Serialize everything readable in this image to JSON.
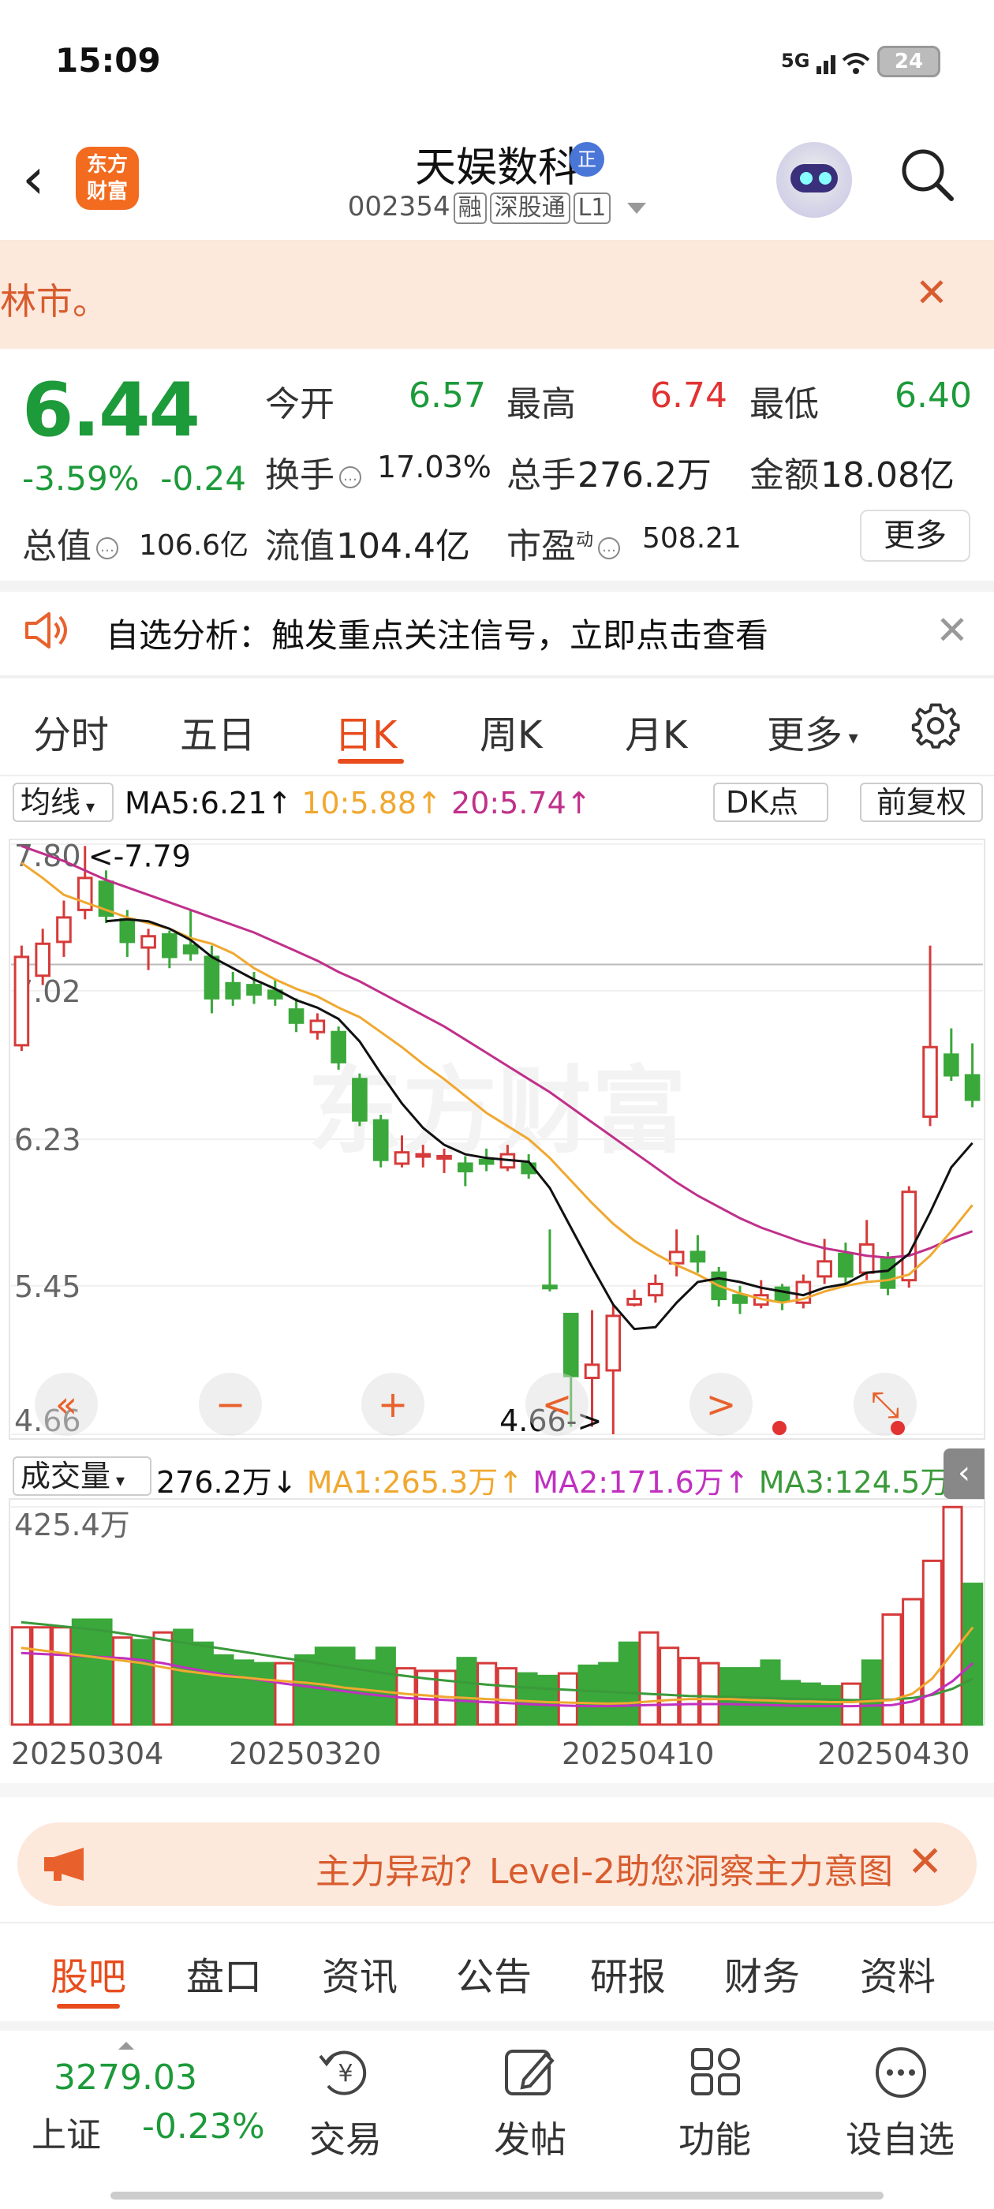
{
  "status": {
    "time": "15:09",
    "signal": "5G",
    "battery": "24"
  },
  "header": {
    "logo": [
      "东方",
      "财富"
    ],
    "name": "天娱数科",
    "name_badge": "正",
    "code": "002354",
    "tags": [
      "融",
      "深股通",
      "L1"
    ]
  },
  "banner": {
    "text": "林市。"
  },
  "quote": {
    "price": "6.44",
    "pct": "-3.59%",
    "chg": "-0.24",
    "open_label": "今开",
    "open": "6.57",
    "high_label": "最高",
    "high": "6.74",
    "low_label": "最低",
    "low": "6.40",
    "turnover_label": "换手",
    "turnover": "17.03%",
    "volume_label": "总手",
    "volume": "276.2万",
    "amount_label": "金额",
    "amount": "18.08亿",
    "mcap_label": "总值",
    "mcap": "106.6亿",
    "float_label": "流值",
    "float": "104.4亿",
    "pe_label": "市盈",
    "pe_sup": "动",
    "pe": "508.21",
    "more": "更多"
  },
  "analysis": {
    "text": "自选分析：触发重点关注信号，立即点击查看"
  },
  "period_tabs": [
    "分时",
    "五日",
    "日K",
    "周K",
    "月K",
    "更多"
  ],
  "ma_row": {
    "selector": "均线",
    "ma5": "MA5:6.21",
    "ma10": "10:5.88",
    "ma20": "20:5.74",
    "dk": "DK点",
    "adjust": "前复权"
  },
  "colors": {
    "ma5": "#111111",
    "ma10": "#f0a830",
    "ma20": "#c0308a",
    "up": "#d63a3a",
    "down": "#3aa83a",
    "accent": "#e84c1c"
  },
  "chart_data": [
    {
      "type": "candlestick",
      "ylim": [
        4.66,
        7.8
      ],
      "y_ticks": [
        "7.80",
        "7.02",
        "6.23",
        "5.45",
        "4.66"
      ],
      "high_marker": "<-7.79",
      "low_marker": "4.66->",
      "watermark": "东方财富",
      "x_labels": [
        "20250304",
        "20250320",
        "20250410",
        "20250430"
      ],
      "reference_line": 7.16,
      "candles": [
        [
          6.73,
          7.2,
          7.26,
          6.7
        ],
        [
          7.1,
          7.27,
          7.35,
          7.05
        ],
        [
          7.28,
          7.41,
          7.5,
          7.2
        ],
        [
          7.45,
          7.62,
          7.79,
          7.4
        ],
        [
          7.6,
          7.42,
          7.66,
          7.38
        ],
        [
          7.4,
          7.28,
          7.45,
          7.2
        ],
        [
          7.25,
          7.31,
          7.35,
          7.13
        ],
        [
          7.32,
          7.2,
          7.34,
          7.14
        ],
        [
          7.26,
          7.22,
          7.45,
          7.18
        ],
        [
          7.2,
          6.98,
          7.26,
          6.9
        ],
        [
          7.06,
          6.98,
          7.12,
          6.94
        ],
        [
          7.05,
          7.0,
          7.12,
          6.95
        ],
        [
          7.02,
          6.98,
          7.08,
          6.94
        ],
        [
          6.92,
          6.85,
          6.98,
          6.8
        ],
        [
          6.8,
          6.86,
          6.9,
          6.76
        ],
        [
          6.8,
          6.64,
          6.83,
          6.6
        ],
        [
          6.55,
          6.33,
          6.58,
          6.3
        ],
        [
          6.33,
          6.12,
          6.36,
          6.08
        ],
        [
          6.1,
          6.16,
          6.25,
          6.08
        ],
        [
          6.14,
          6.15,
          6.2,
          6.08
        ],
        [
          6.14,
          6.14,
          6.18,
          6.05
        ],
        [
          6.1,
          6.06,
          6.14,
          5.98
        ],
        [
          6.12,
          6.1,
          6.18,
          6.06
        ],
        [
          6.08,
          6.15,
          6.2,
          6.06
        ],
        [
          6.1,
          6.05,
          6.15,
          6.02
        ],
        [
          5.45,
          5.44,
          5.75,
          5.42
        ],
        [
          5.3,
          4.97,
          5.3,
          4.7
        ],
        [
          4.96,
          5.03,
          5.32,
          4.7
        ],
        [
          5.0,
          5.29,
          5.35,
          4.66
        ],
        [
          5.35,
          5.38,
          5.43,
          5.34
        ],
        [
          5.4,
          5.46,
          5.51,
          5.36
        ],
        [
          5.57,
          5.63,
          5.75,
          5.5
        ],
        [
          5.63,
          5.58,
          5.72,
          5.52
        ],
        [
          5.52,
          5.38,
          5.55,
          5.34
        ],
        [
          5.4,
          5.36,
          5.45,
          5.3
        ],
        [
          5.35,
          5.4,
          5.48,
          5.33
        ],
        [
          5.44,
          5.37,
          5.46,
          5.32
        ],
        [
          5.36,
          5.47,
          5.51,
          5.33
        ],
        [
          5.5,
          5.58,
          5.7,
          5.46
        ],
        [
          5.62,
          5.5,
          5.68,
          5.46
        ],
        [
          5.52,
          5.67,
          5.8,
          5.48
        ],
        [
          5.6,
          5.44,
          5.63,
          5.4
        ],
        [
          5.48,
          5.95,
          5.98,
          5.44
        ],
        [
          6.35,
          6.72,
          7.26,
          6.3
        ],
        [
          6.68,
          6.57,
          6.82,
          6.54
        ],
        [
          6.57,
          6.44,
          6.74,
          6.4
        ]
      ],
      "ma5": [
        null,
        null,
        null,
        null,
        7.39,
        7.4,
        7.39,
        7.35,
        7.29,
        7.2,
        7.14,
        7.08,
        7.03,
        6.97,
        6.93,
        6.87,
        6.75,
        6.58,
        6.42,
        6.29,
        6.2,
        6.15,
        6.13,
        6.12,
        6.11,
        5.97,
        5.76,
        5.55,
        5.35,
        5.22,
        5.23,
        5.36,
        5.47,
        5.49,
        5.47,
        5.44,
        5.42,
        5.4,
        5.44,
        5.46,
        5.52,
        5.53,
        5.62,
        5.84,
        6.08,
        6.21
      ],
      "ma10": [
        7.7,
        7.62,
        7.53,
        7.49,
        7.45,
        7.41,
        7.38,
        7.35,
        7.3,
        7.27,
        7.22,
        7.14,
        7.08,
        7.03,
        6.99,
        6.93,
        6.88,
        6.8,
        6.72,
        6.63,
        6.55,
        6.46,
        6.37,
        6.3,
        6.23,
        6.13,
        6.01,
        5.89,
        5.78,
        5.69,
        5.62,
        5.56,
        5.51,
        5.45,
        5.41,
        5.38,
        5.36,
        5.38,
        5.42,
        5.45,
        5.47,
        5.48,
        5.51,
        5.61,
        5.74,
        5.88
      ],
      "ma20": [
        7.79,
        7.75,
        7.71,
        7.66,
        7.61,
        7.57,
        7.53,
        7.49,
        7.45,
        7.41,
        7.37,
        7.33,
        7.28,
        7.23,
        7.18,
        7.12,
        7.07,
        7.01,
        6.95,
        6.89,
        6.83,
        6.76,
        6.69,
        6.62,
        6.55,
        6.48,
        6.4,
        6.32,
        6.24,
        6.16,
        6.08,
        6.0,
        5.93,
        5.87,
        5.81,
        5.76,
        5.72,
        5.68,
        5.65,
        5.63,
        5.61,
        5.6,
        5.61,
        5.65,
        5.7,
        5.74
      ]
    },
    {
      "type": "bar",
      "label": "成交量",
      "ylim": [
        0,
        425.4
      ],
      "y_tick": "425.4万",
      "current": "276.2万",
      "ma1": "MA1:265.3万",
      "ma2": "MA2:171.6万",
      "ma3": "MA3:124.5万",
      "volumes": [
        190,
        190,
        190,
        205,
        205,
        170,
        165,
        180,
        185,
        160,
        135,
        125,
        120,
        120,
        135,
        150,
        150,
        125,
        150,
        110,
        105,
        105,
        130,
        120,
        110,
        100,
        95,
        100,
        115,
        120,
        160,
        180,
        150,
        130,
        120,
        110,
        110,
        125,
        85,
        80,
        75,
        80,
        125,
        215,
        245,
        320,
        425,
        275
      ],
      "up_flags": [
        1,
        1,
        1,
        0,
        0,
        1,
        0,
        1,
        0,
        0,
        0,
        0,
        0,
        1,
        0,
        0,
        0,
        0,
        0,
        1,
        1,
        1,
        0,
        1,
        1,
        0,
        0,
        1,
        0,
        0,
        0,
        1,
        1,
        1,
        1,
        0,
        0,
        0,
        0,
        0,
        0,
        1,
        0,
        1,
        1,
        1,
        1,
        0
      ],
      "ma1_line": [
        150,
        145,
        140,
        135,
        130,
        125,
        120,
        112,
        105,
        100,
        95,
        92,
        88,
        85,
        82,
        78,
        72,
        68,
        64,
        60,
        57,
        54,
        52,
        50,
        48,
        46,
        44,
        43,
        42,
        41,
        42,
        45,
        48,
        50,
        50,
        50,
        48,
        47,
        45,
        45,
        44,
        44,
        46,
        48,
        60,
        90,
        140,
        190
      ],
      "ma2_line": [
        140,
        138,
        136,
        134,
        132,
        130,
        126,
        120,
        112,
        105,
        98,
        92,
        86,
        80,
        75,
        70,
        65,
        60,
        56,
        52,
        50,
        48,
        46,
        44,
        42,
        40,
        38,
        37,
        36,
        36,
        37,
        38,
        39,
        40,
        40,
        40,
        39,
        38,
        37,
        36,
        36,
        36,
        37,
        38,
        45,
        60,
        85,
        120
      ],
      "ma3_line": [
        200,
        196,
        192,
        188,
        184,
        178,
        172,
        166,
        160,
        154,
        148,
        142,
        136,
        130,
        124,
        118,
        112,
        106,
        100,
        95,
        90,
        86,
        82,
        78,
        75,
        72,
        70,
        68,
        66,
        64,
        62,
        60,
        58,
        56,
        55,
        54,
        53,
        52,
        51,
        50,
        49,
        48,
        48,
        49,
        52,
        58,
        70,
        90
      ]
    }
  ],
  "chart_controls": [
    "«",
    "−",
    "+",
    "<",
    ">",
    "⤡"
  ],
  "promo": {
    "text": "主力异动？Level-2助您洞察主力意图"
  },
  "bottom_tabs": [
    "股吧",
    "盘口",
    "资讯",
    "公告",
    "研报",
    "财务",
    "资料"
  ],
  "footer": {
    "index_value": "3279.03",
    "index_name": "上证",
    "index_chg": "-0.23%",
    "items": [
      "交易",
      "发帖",
      "功能",
      "设自选"
    ]
  }
}
